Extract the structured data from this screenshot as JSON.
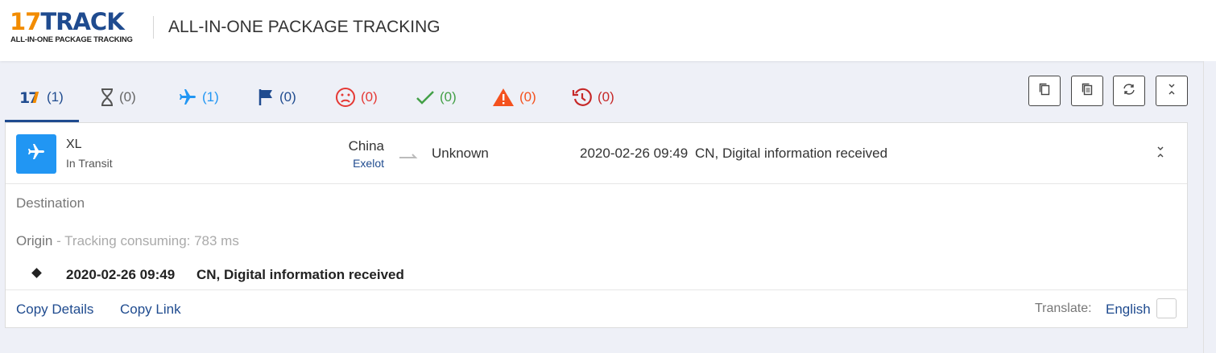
{
  "header": {
    "logo_number": "17",
    "logo_word": "TRACK",
    "logo_tagline": "ALL-IN-ONE PACKAGE TRACKING",
    "title": "ALL-IN-ONE PACKAGE TRACKING"
  },
  "tabs": [
    {
      "icon": "17-logo-icon",
      "count": "(1)",
      "color": "#1f4b8f"
    },
    {
      "icon": "hourglass-icon",
      "count": "(0)",
      "color": "#666666"
    },
    {
      "icon": "airplane-icon",
      "count": "(1)",
      "color": "#2196f3"
    },
    {
      "icon": "flag-icon",
      "count": "(0)",
      "color": "#1f4b8f"
    },
    {
      "icon": "sad-face-icon",
      "count": "(0)",
      "color": "#e53935"
    },
    {
      "icon": "checkmark-icon",
      "count": "(0)",
      "color": "#43a047"
    },
    {
      "icon": "warning-icon",
      "count": "(0)",
      "color": "#f4511e"
    },
    {
      "icon": "history-icon",
      "count": "(0)",
      "color": "#c62828"
    }
  ],
  "toolbar": {
    "buttons": [
      "copy-icon",
      "copy-list-icon",
      "refresh-icon",
      "collapse-all-icon"
    ]
  },
  "shipment": {
    "tracking_number": "XL",
    "status": "In Transit",
    "origin_country": "China",
    "carrier": "Exelot",
    "destination_country": "Unknown",
    "latest_time": "2020-02-26 09:49",
    "latest_event": "CN, Digital information received",
    "destination_label": "Destination",
    "origin_label": "Origin",
    "consuming_text": " - Tracking consuming: 783 ms",
    "events": [
      {
        "time": "2020-02-26 09:49",
        "description": "CN, Digital information received"
      }
    ]
  },
  "footer": {
    "copy_details": "Copy Details",
    "copy_link": "Copy Link",
    "translate_label": "Translate:",
    "translate_language": "English"
  },
  "colors": {
    "brand_orange": "#f28c00",
    "brand_blue": "#1f4b8f",
    "status_blue": "#2196f3"
  }
}
